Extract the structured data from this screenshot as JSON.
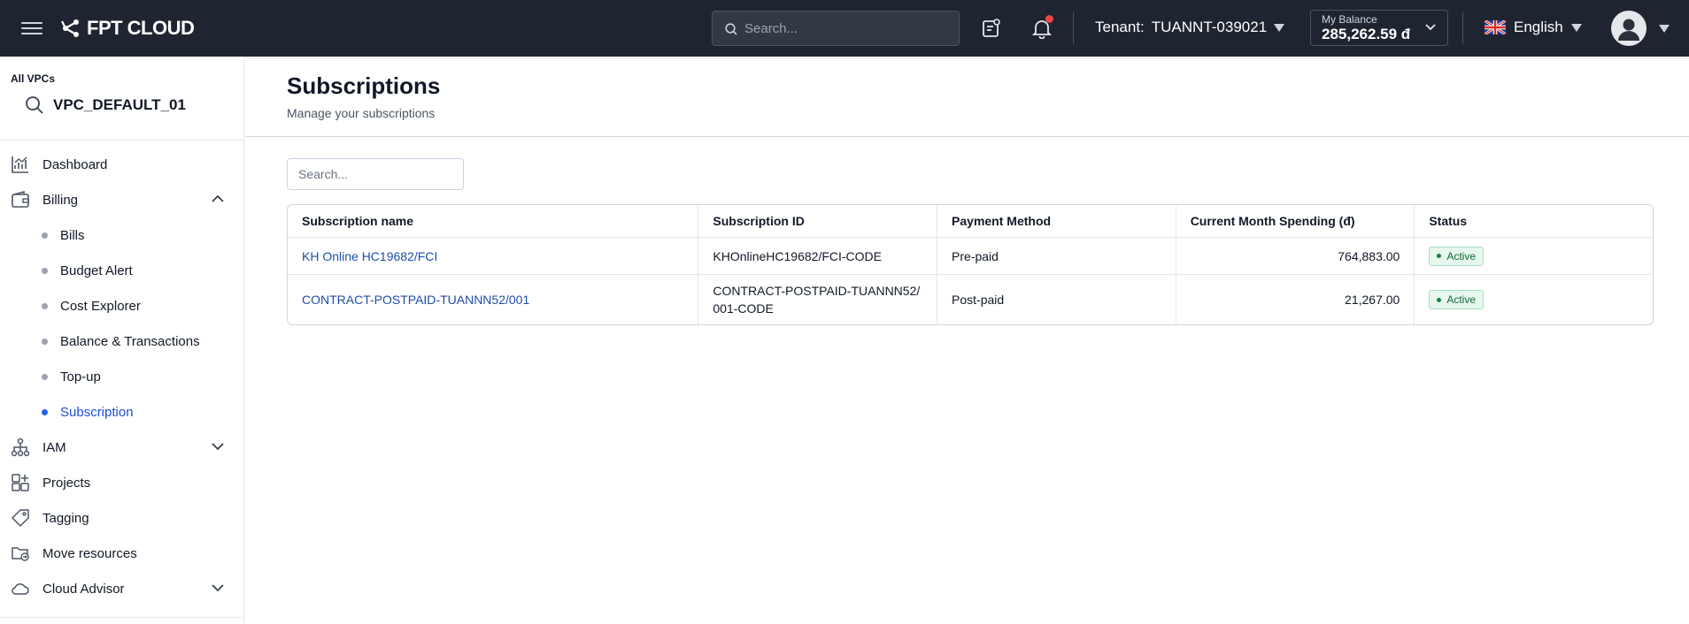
{
  "header": {
    "logo_text": "FPT CLOUD",
    "search_placeholder": "Search...",
    "tenant_label": "Tenant:",
    "tenant_value": "TUANNT-039021",
    "balance_label": "My Balance",
    "balance_value": "285,262.59 đ",
    "language": "English"
  },
  "sidebar": {
    "vpc_label": "All VPCs",
    "vpc_name": "VPC_DEFAULT_01",
    "items": [
      {
        "label": "Dashboard",
        "icon": "chart-line-icon"
      },
      {
        "label": "Billing",
        "icon": "wallet-icon",
        "expanded": true
      },
      {
        "label": "IAM",
        "icon": "hierarchy-icon"
      },
      {
        "label": "Projects",
        "icon": "grid-plus-icon"
      },
      {
        "label": "Tagging",
        "icon": "tag-icon"
      },
      {
        "label": "Move resources",
        "icon": "folder-move-icon"
      },
      {
        "label": "Cloud Advisor",
        "icon": "cloud-icon"
      }
    ],
    "billing_sub": [
      {
        "label": "Bills"
      },
      {
        "label": "Budget Alert"
      },
      {
        "label": "Cost Explorer"
      },
      {
        "label": "Balance & Transactions"
      },
      {
        "label": "Top-up"
      },
      {
        "label": "Subscription",
        "active": true
      }
    ]
  },
  "main": {
    "title": "Subscriptions",
    "subtitle": "Manage your subscriptions",
    "search_placeholder": "Search...",
    "columns": [
      "Subscription name",
      "Subscription ID",
      "Payment Method",
      "Current Month Spending (đ)",
      "Status"
    ],
    "rows": [
      {
        "name": "KH Online HC19682/FCI",
        "id": "KHOnlineHC19682/FCI-CODE",
        "payment": "Pre-paid",
        "spending": "764,883.00",
        "status": "Active"
      },
      {
        "name": "CONTRACT-POSTPAID-TUANNN52/001",
        "id": "CONTRACT-POSTPAID-TUANNN52/001-CODE",
        "payment": "Post-paid",
        "spending": "21,267.00",
        "status": "Active"
      }
    ]
  },
  "colors": {
    "topbar_bg": "#1f2530",
    "accent": "#1d4ed8",
    "active_badge_bg": "#e6f7ee",
    "notification": "#ef4444"
  }
}
